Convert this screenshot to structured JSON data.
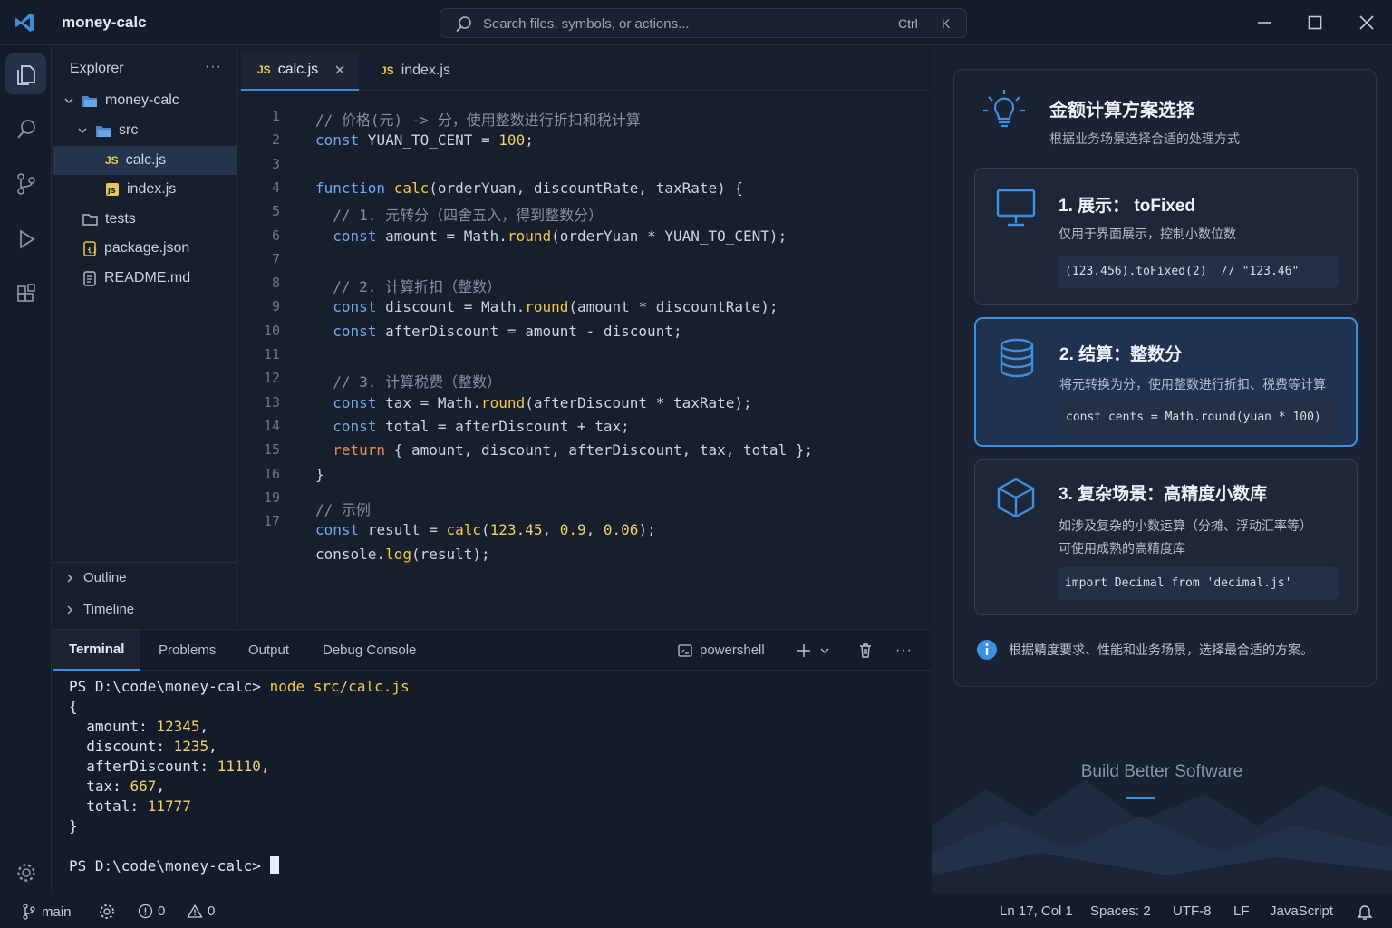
{
  "app": {
    "title": "money-calc"
  },
  "search": {
    "placeholder": "Search files, symbols, or actions...",
    "key1": "Ctrl",
    "key2": "K"
  },
  "sidebar": {
    "title": "Explorer",
    "more": "···",
    "tree": [
      {
        "label": "money-calc"
      },
      {
        "label": "src"
      },
      {
        "label": "calc.js"
      },
      {
        "label": "index.js"
      },
      {
        "label": "tests"
      },
      {
        "label": "package.json"
      },
      {
        "label": "README.md"
      }
    ],
    "sections": [
      {
        "label": "Outline"
      },
      {
        "label": "Timeline"
      }
    ]
  },
  "editor": {
    "tabs": [
      {
        "label": "calc.js",
        "badge": "JS"
      },
      {
        "label": "index.js",
        "badge": "JS"
      }
    ],
    "line_numbers": [
      "1",
      "2",
      "3",
      "4",
      "5",
      "6",
      "7",
      "8",
      "9",
      "10",
      "11",
      "12",
      "13",
      "14",
      "15",
      "16",
      "19",
      "17"
    ],
    "lines": [
      "// 价格(元) -> 分，使用整数进行折扣和税计算",
      "const YUAN_TO_CENT = 100;",
      "",
      "function calc(orderYuan, discountRate, taxRate) {",
      "  // 1. 元转分（四舍五入，得到整数分）",
      "  const amount = Math.round(orderYuan * YUAN_TO_CENT);",
      "",
      "  // 2. 计算折扣（整数）",
      "  const discount = Math.round(amount * discountRate);",
      "  const afterDiscount = amount - discount;",
      "",
      "  // 3. 计算税费（整数）",
      "  const tax = Math.round(afterDiscount * taxRate);",
      "  const total = afterDiscount + tax;",
      "  return { amount, discount, afterDiscount, tax, total };",
      "}",
      "// 示例",
      "const result = calc(123.45, 0.9, 0.06);",
      "console.log(result);"
    ]
  },
  "panel": {
    "tabs": [
      "Terminal",
      "Problems",
      "Output",
      "Debug Console"
    ],
    "shell": "powershell",
    "terminal": {
      "prompt": "PS D:\\code\\money-calc>",
      "command": "node src/calc.js",
      "open": "{",
      "rows": [
        {
          "key": "amount",
          "value": "12345"
        },
        {
          "key": "discount",
          "value": "1235"
        },
        {
          "key": "afterDiscount",
          "value": "11110"
        },
        {
          "key": "tax",
          "value": "667"
        },
        {
          "key": "total",
          "value": "11777"
        }
      ],
      "close": "}"
    }
  },
  "status": {
    "branch": "main",
    "errors": "0",
    "warnings": "0",
    "position": "Ln 17, Col 1",
    "spaces": "Spaces: 2",
    "encoding": "UTF-8",
    "eol": "LF",
    "language": "JavaScript"
  },
  "card": {
    "title": "金额计算方案选择",
    "subtitle": "根据业务场景选择合适的处理方式",
    "options": [
      {
        "title": "1. 展示： toFixed",
        "desc": [
          "仅用于界面展示，控制小数位数"
        ],
        "code": "(123.456).toFixed(2)  // \"123.46\"",
        "icon": "monitor-icon"
      },
      {
        "title": "2. 结算：整数分",
        "desc": [
          "将元转换为分，使用整数进行折扣、税费等计算"
        ],
        "code": "const cents = Math.round(yuan * 100)",
        "icon": "database-icon"
      },
      {
        "title": "3. 复杂场景：高精度小数库",
        "desc": [
          "如涉及复杂的小数运算（分摊、浮动汇率等）",
          "可使用成熟的高精度库"
        ],
        "code": "import Decimal from 'decimal.js'",
        "icon": "cube-icon"
      }
    ],
    "info": "根据精度要求、性能和业务场景，选择最合适的方案。"
  },
  "brand": {
    "tagline": "Build Better Software"
  },
  "colors": {
    "accent": "#3f8fe0",
    "background": "#161d2b",
    "js_badge": "#f0c94a"
  }
}
